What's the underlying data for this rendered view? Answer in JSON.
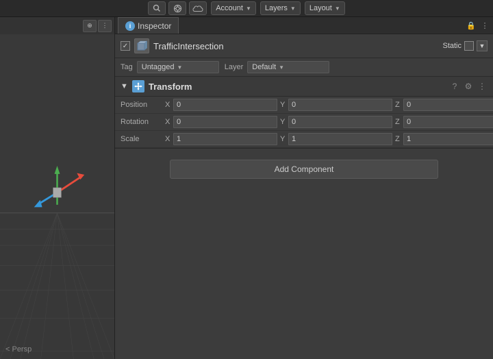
{
  "topbar": {
    "account_label": "Account",
    "layers_label": "Layers",
    "layout_label": "Layout"
  },
  "viewport": {
    "persp_label": "< Persp"
  },
  "inspector": {
    "tab_label": "Inspector",
    "lock_icon": "🔒",
    "more_icon": "⋮"
  },
  "gameobject": {
    "name": "TrafficIntersection",
    "enabled": true,
    "static_label": "Static"
  },
  "tag_layer": {
    "tag_label": "Tag",
    "tag_value": "Untagged",
    "layer_label": "Layer",
    "layer_value": "Default"
  },
  "transform": {
    "component_name": "Transform",
    "position_label": "Position",
    "rotation_label": "Rotation",
    "scale_label": "Scale",
    "position": {
      "x": "0",
      "y": "0",
      "z": "0"
    },
    "rotation": {
      "x": "0",
      "y": "0",
      "z": "0"
    },
    "scale": {
      "x": "1",
      "y": "1",
      "z": "1"
    }
  },
  "add_component": {
    "label": "Add Component"
  }
}
